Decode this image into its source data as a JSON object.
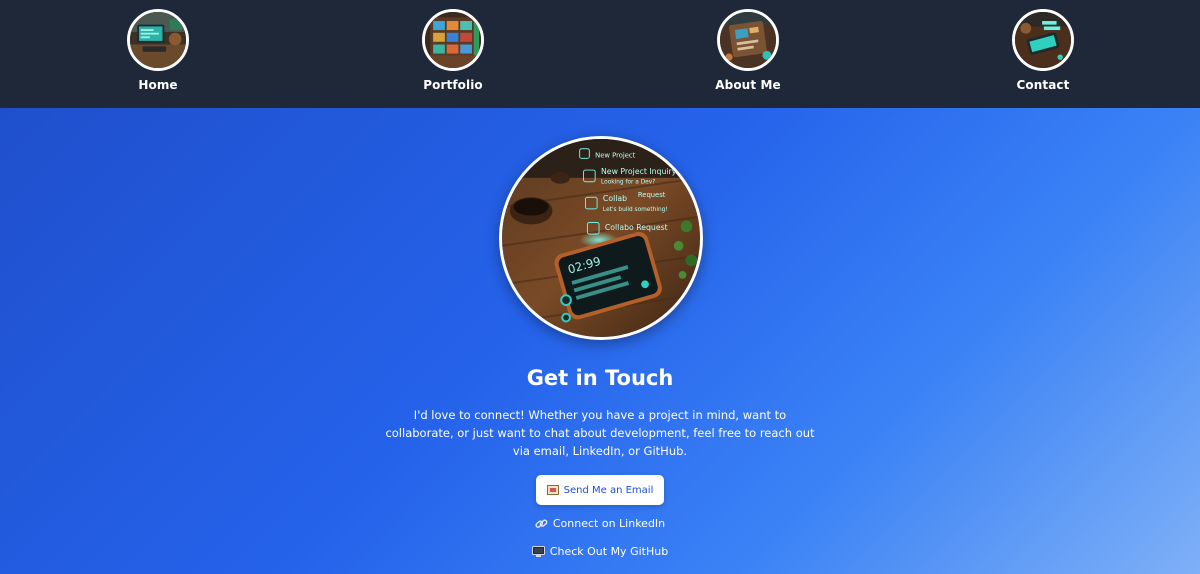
{
  "nav": {
    "items": [
      {
        "label": "Home",
        "icon": "home-thumbnail"
      },
      {
        "label": "Portfolio",
        "icon": "portfolio-thumbnail"
      },
      {
        "label": "About Me",
        "icon": "about-thumbnail"
      },
      {
        "label": "Contact",
        "icon": "contact-thumbnail"
      }
    ]
  },
  "contact": {
    "title": "Get in Touch",
    "description": "I'd love to connect! Whether you have a project in mind, want to collaborate, or just want to chat about development, feel free to reach out via email, LinkedIn, or GitHub.",
    "email_button": "Send Me an Email",
    "linkedin_link": "Connect on LinkedIn",
    "github_link": "Check Out My GitHub",
    "photo_text": {
      "time": "02:99",
      "n1": "New Project",
      "n2a": "New Project Inquiry!",
      "n2b": "Looking for a Dev?",
      "n3a": "Collab",
      "n3b": "Request",
      "n3c": "Let's build something!",
      "n4": "Collabo Request"
    }
  },
  "colors": {
    "nav_bg": "#1f2838",
    "hero_gradient_start": "#1f4fcc",
    "hero_gradient_end": "#7eb0f7",
    "button_text": "#1d4ed8"
  }
}
